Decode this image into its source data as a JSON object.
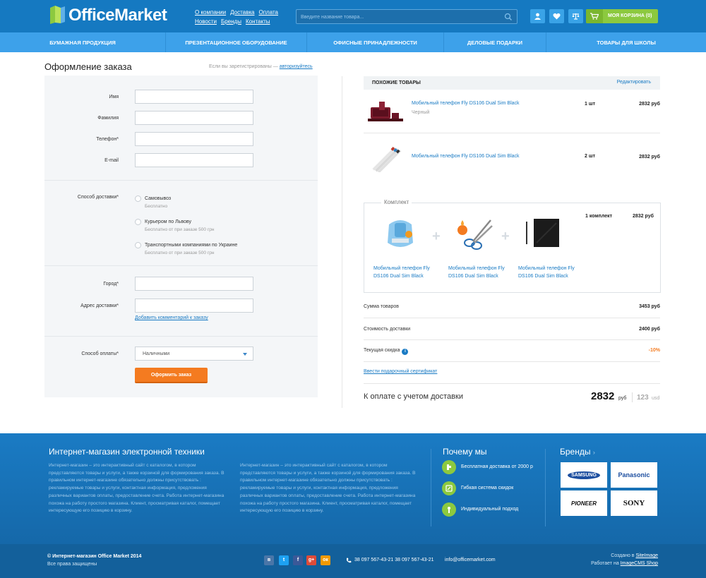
{
  "header": {
    "logo_text": "OfficeMarket",
    "top_links": [
      "О компании",
      "Доставка",
      "Оплата",
      "Новости",
      "Бренды",
      "Контакты"
    ],
    "search_placeholder": "Введите название товара...",
    "cart_label": "МОЯ КОРЗИНА (0)"
  },
  "nav": [
    "БУМАЖНАЯ ПРОДУКЦИЯ",
    "ПРЕЗЕНТАЦИОННОЕ ОБОРУДОВАНИЕ",
    "ОФИСНЫЕ ПРИНАДЛЕЖНОСТИ",
    "ДЕЛОВЫЕ ПОДАРКИ",
    "ТОВАРЫ ДЛЯ ШКОЛЫ"
  ],
  "checkout": {
    "title": "Оформление заказа",
    "login_hint": "Если вы зарегистрированы —",
    "login_link": "авторизуйтесь",
    "fields": {
      "first_name": "Имя",
      "last_name": "Фамилия",
      "phone": "Телефон*",
      "email": "E-mail",
      "delivery": "Способ доставки*",
      "city": "Город*",
      "address": "Адрес доставки*",
      "payment": "Способ оплаты*"
    },
    "delivery_options": [
      {
        "label": "Самовывоз",
        "sub": "Бесплатно"
      },
      {
        "label": "Курьером по Львову",
        "sub": "Бесплатно от при заказе 500 грн"
      },
      {
        "label": "Транспортными компаниями по Украине",
        "sub": "Бесплатно от при заказе 500 грн"
      }
    ],
    "add_comment": "Добавить комментарий к заказу",
    "payment_value": "Наличными",
    "submit": "Оформить заказ"
  },
  "similar": {
    "title": "ПОХОЖИЕ ТОВАРЫ",
    "edit": "Редактировать",
    "items": [
      {
        "name": "Мобильный телефон Fly DS106 Dual Sim Black",
        "color": "Черный",
        "qty": "1 шт",
        "price": "2832 руб"
      },
      {
        "name": "Мобильный телефон Fly DS106 Dual Sim Black",
        "color": "",
        "qty": "2 шт",
        "price": "2832 руб"
      }
    ],
    "kit": {
      "label": "Комплект",
      "items": [
        "Мобильный телефон Fly DS106 Dual Sim Black",
        "Мобильный телефон Fly DS106 Dual Sim Black",
        "Мобильный телефон Fly DS106 Dual Sim Black"
      ],
      "qty": "1 комплект",
      "price": "2832 руб"
    }
  },
  "summary": {
    "items_label": "Сумма товаров",
    "items_value": "3453 руб",
    "delivery_label": "Стоимость доставки",
    "delivery_value": "2400 руб",
    "discount_label": "Текущая скидка",
    "discount_value": "-10%",
    "certificate": "Ввести подарочный сертификат",
    "total_label": "К оплате с учетом доставки",
    "total_value": "2832",
    "total_currency": "руб",
    "total_usd": "123",
    "total_usd_currency": "usd"
  },
  "footer": {
    "about_title": "Интернет-магазин электронной техники",
    "about_text_1": "Интернет-магазин – это интерактивный сайт с каталогом, в котором представляются товары и услуги, а также корзиной для формирования заказа. В правильном интернет-магазине обязательно должны присутствовать : рекламируемые товары и услуги, контактная информация, предложения различных вариантов оплаты, предоставление счета. Работа интернет-магазина похожа на работу простого магазина. Клиент, просматривая каталог, помещает интересующую его позицию в корзину.",
    "about_text_2": "Интернет-магазин – это интерактивный сайт с каталогом, в котором представляются товары и услуги, а также корзиной для формирования заказа. В правильном интернет-магазине обязательно должны присутствовать : рекламируемые товары и услуги, контактная информация, предложения различных вариантов оплаты, предоставление счета. Работа интернет-магазина похожа на работу простого магазина. Клиент, просматривая каталог, помещает интересующую его позицию в корзину.",
    "why_title": "Почему мы",
    "why_items": [
      "Бесплатная доставка от 2000 р",
      "Гибкая система  скидок",
      "Индивидуальный подход"
    ],
    "brands_title": "Бренды",
    "brands": [
      "SAMSUNG",
      "Panasonic",
      "PIONEER",
      "SONY"
    ],
    "copyright": "© Интернет-магазин Office Market 2014",
    "rights": "Все права защищены",
    "social": [
      "в",
      "t",
      "f",
      "g+",
      "ок"
    ],
    "phones": "38 097 567-43-21   38 097 567-43-21",
    "email": "info@officemarket.com",
    "created_prefix": "Создано в",
    "created_link": "SiteImage",
    "works_prefix": "Работает на",
    "works_link": "ImageCMS Shop"
  },
  "colors": {
    "primary": "#1579c1",
    "nav": "#3da1ea",
    "accent": "#f47b20",
    "green": "#8cc93f"
  }
}
